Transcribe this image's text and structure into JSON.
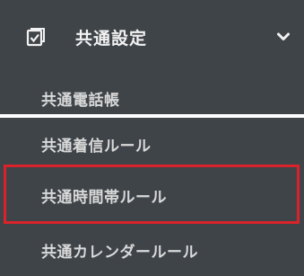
{
  "section": {
    "title": "共通設定",
    "icon": "checkbox-icon",
    "toggle_icon": "chevron-down-icon"
  },
  "items": [
    {
      "label": "共通電話帳"
    },
    {
      "label": "共通着信ルール"
    },
    {
      "label": "共通時間帯ルール",
      "highlighted": true
    },
    {
      "label": "共通カレンダールール"
    }
  ],
  "colors": {
    "background": "#3f4449",
    "text": "#d9d9d9",
    "highlight_border": "#d9232a",
    "divider": "#ffffff"
  }
}
